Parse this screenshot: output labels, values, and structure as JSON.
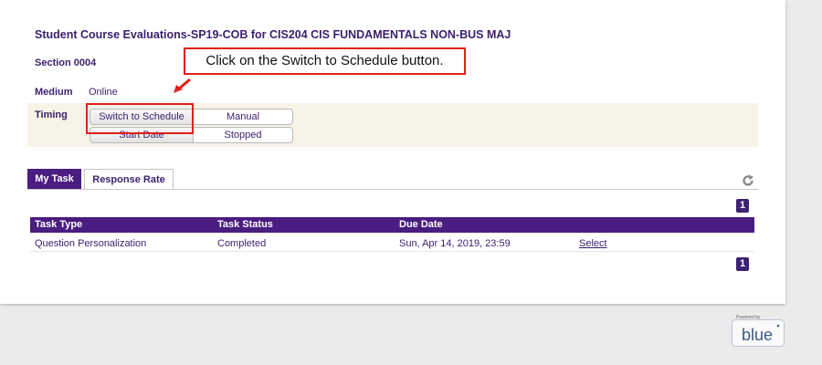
{
  "header": {
    "title": "Student Course Evaluations-SP19-COB for CIS204 CIS FUNDAMENTALS NON-BUS MAJ",
    "section": "Section 0004"
  },
  "callout": {
    "text": "Click on the Switch to Schedule button."
  },
  "info": {
    "medium_label": "Medium",
    "medium_value": "Online",
    "timing_label": "Timing",
    "switch_button": "Switch to Schedule",
    "manual_label": "Manual",
    "start_date_label": "Start Date",
    "status_label": "Stopped"
  },
  "tabs": [
    {
      "label": "My Task",
      "active": true
    },
    {
      "label": "Response Rate",
      "active": false
    }
  ],
  "pagination": {
    "page": "1"
  },
  "table": {
    "headers": [
      "Task Type",
      "Task Status",
      "Due Date"
    ],
    "rows": [
      {
        "task_type": "Question Personalization",
        "task_status": "Completed",
        "due_date": "Sun, Apr 14, 2019, 23:59",
        "action": "Select"
      }
    ]
  },
  "footer": {
    "powered_by": "Powered by",
    "brand": "blue"
  },
  "colors": {
    "accent": "#4a1d80",
    "highlight": "#e0201b",
    "text": "#3b1f6e"
  }
}
